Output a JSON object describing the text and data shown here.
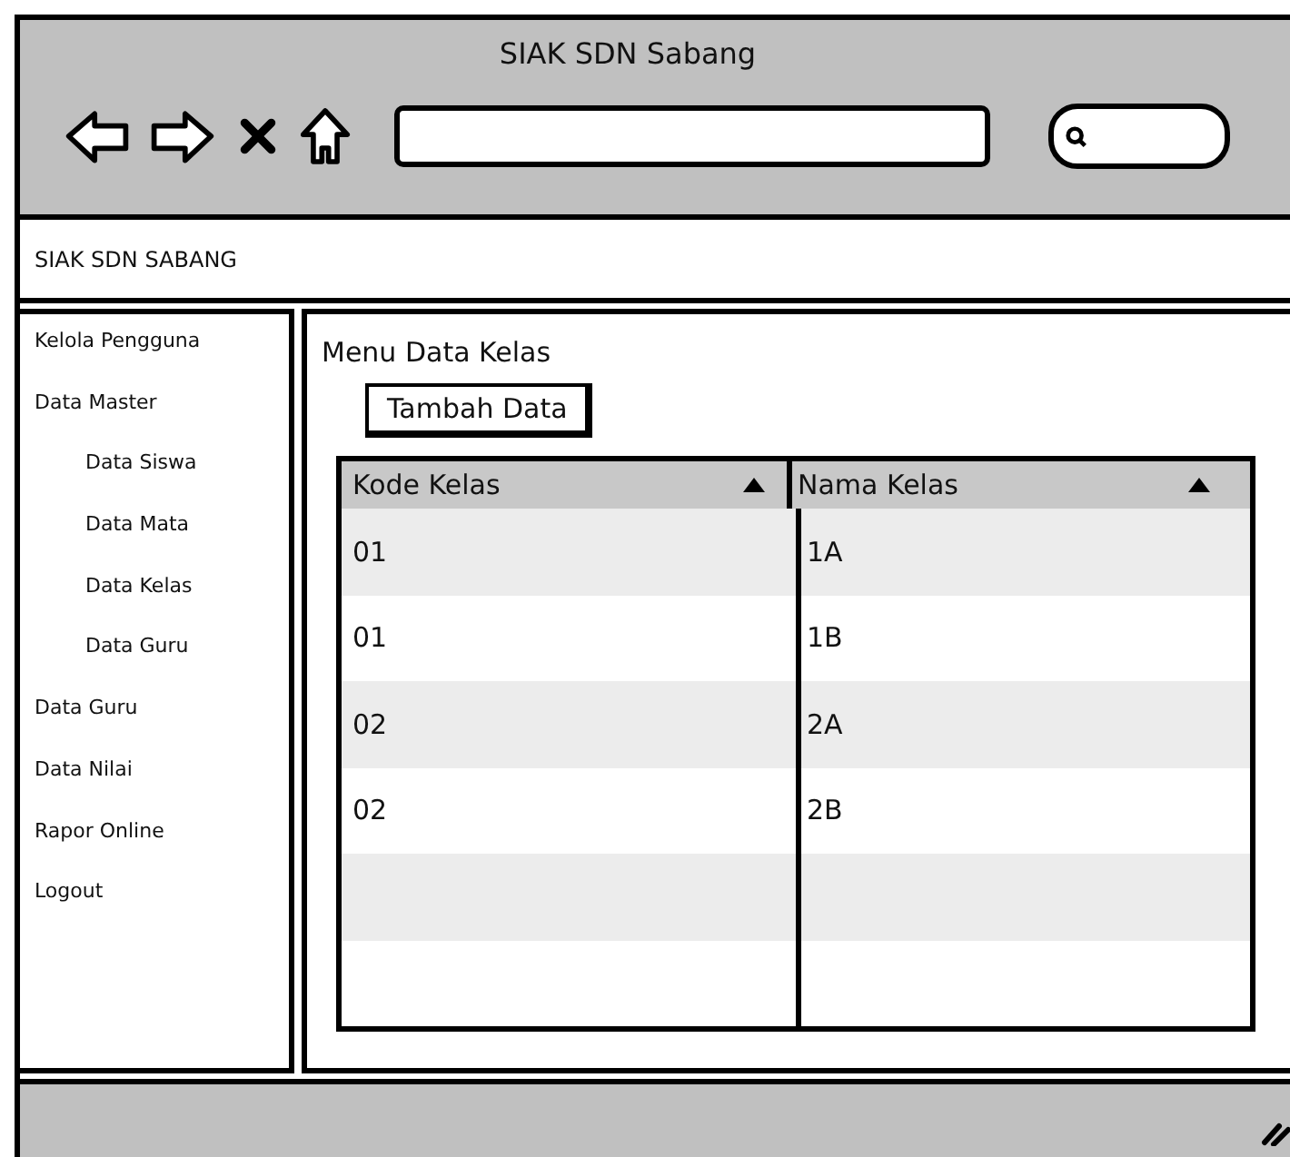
{
  "window": {
    "title": "SIAK SDN Sabang"
  },
  "header": {
    "title": "SIAK SDN SABANG"
  },
  "sidebar": {
    "items": [
      {
        "label": "Kelola Pengguna"
      },
      {
        "label": "Data Master",
        "children": [
          {
            "label": "Data Siswa"
          },
          {
            "label": "Data Mata"
          },
          {
            "label": "Data Kelas"
          },
          {
            "label": "Data Guru"
          }
        ]
      },
      {
        "label": "Data Guru"
      },
      {
        "label": "Data Nilai"
      },
      {
        "label": "Rapor Online"
      },
      {
        "label": "Logout"
      }
    ]
  },
  "main": {
    "heading": "Menu Data Kelas",
    "add_button": "Tambah Data",
    "table": {
      "columns": [
        "Kode Kelas",
        "Nama Kelas"
      ],
      "rows": [
        [
          "01",
          "1A"
        ],
        [
          "01",
          "1B"
        ],
        [
          "02",
          "2A"
        ],
        [
          "02",
          "2B"
        ]
      ]
    }
  }
}
